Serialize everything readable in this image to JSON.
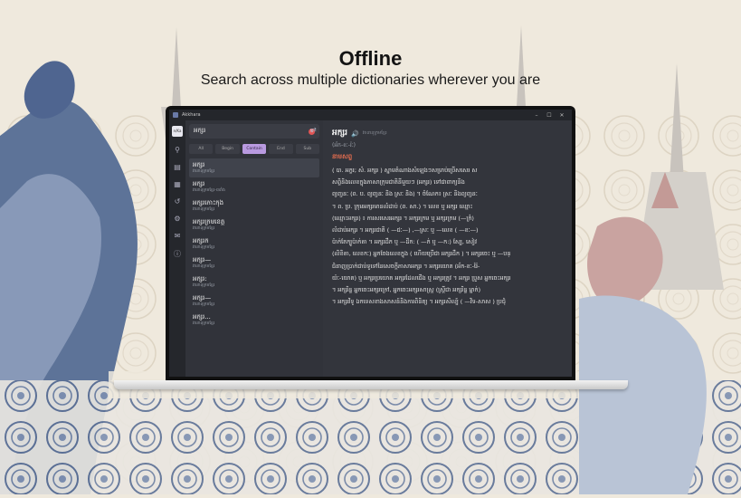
{
  "hero": {
    "title": "Offline",
    "subtitle": "Search across multiple dictionaries wherever you are"
  },
  "window": {
    "title": "Akkhara",
    "controls": [
      "–",
      "☐",
      "✕"
    ]
  },
  "rail": {
    "logo_text": "ក/Ka",
    "icons": [
      "search-icon",
      "book-icon",
      "dictionary-icon",
      "history-icon",
      "settings-icon",
      "mail-icon",
      "info-icon"
    ]
  },
  "search": {
    "query": "អក្សរ",
    "clear_symbol": "✕"
  },
  "filters": [
    {
      "label": "All",
      "active": false
    },
    {
      "label": "Begin",
      "active": false
    },
    {
      "label": "Contain",
      "active": true
    },
    {
      "label": "End",
      "active": false
    },
    {
      "label": "Sub",
      "active": false
    }
  ],
  "entries": [
    {
      "word": "អក្សរ",
      "source": "វចនានុក្រមខ្មែរ",
      "selected": true
    },
    {
      "word": "អក្សរ",
      "source": "វចនានុក្រមខ្មែរ-បារាំង",
      "selected": false
    },
    {
      "word": "អក្សរកោះកុង",
      "source": "វចនានុក្រមខ្មែរ",
      "selected": false
    },
    {
      "word": "អក្សរក្រមខេត្ត",
      "source": "វចនានុក្រមខ្មែរ",
      "selected": false
    },
    {
      "word": "អក្សរក",
      "source": "វចនានុក្រមខ្មែរ",
      "selected": false
    },
    {
      "word": "អក្សរ—",
      "source": "វចនានុក្រមខ្មែរ",
      "selected": false
    },
    {
      "word": "អក្សរ:",
      "source": "វចនានុក្រមខ្មែរ",
      "selected": false
    },
    {
      "word": "អក្សរ—",
      "source": "វចនានុក្រមខ្មែរ",
      "selected": false
    },
    {
      "word": "អក្សរ...",
      "source": "វចនានុក្រមខ្មែរ",
      "selected": false
    }
  ],
  "detail": {
    "word": "អក្សរ",
    "source": "វចនានុក្រមខ្មែរ",
    "pronunciation": "(អ័ក-ខៈ-រ៉ៈ)",
    "part_of_speech": "នាមសព្ទ",
    "lines": [
      "( បា. អក្ខរ; សំ. អក្សរ ) ស្នាមតំណាងសំឡេងៗសម្រាប់ប្រើសសេរ ស",
      "សព្ទិនិងលេខក្នុងភាសាក្រុមជាតិនីមួយៗ (អក្សរ) ទៅជាពាក្យនិង",
      "ព្យញ្ជនៈ (ព. ប. ព្យញ្ជនៈ និង ស្រៈ និង) ។ ចំណែក៖ ស្រៈ និងព្យញ្ជនៈ",
      "។ ព. ប្រ. ក្រុមអក្សរមានលំដាប់ (ព. សា.) ។ លេខ ឬ អក្សរ ឈ្មោះ",
      "(ឈ្មោះអក្សរ) ៖ ការសរសេរអក្សរ ។ អក្សរក្រម ឬ អក្សរក្រម (—ក្រំ)",
      "លំដាប់អក្សរ ។ អក្សរជាតិ ( —ជៈ—) ,—ស្រៈ ឬ —លេខ ( —ខៈ—)",
      "ប៉ាក់តែក្បូប៉ាក់តា ។ អក្សរដឹក ឬ —ដឹក: ( —ក់ ឬ —ក:) ស្បែ, សៀវ",
      "(លិខិតា, លេខកៈ) អ្នកចែងលេខក្នុង ( ហើយប្រើជា អក្សរដឹក ) ។ អក្សរចេះ ឬ —បន្",
      "ជំនាញប្រាក់ជាប់ទូទៅនៃសេចក្ដីភាសាអក្សរ ។ អក្សរយោគ (អ័ក-ខៈ-រ៉ៃ-",
      "យ៉ៈ-យោគ) ឬ អក្សរប្រយោគ អក្សរដែលជើង ឬ អក្សរត្រូវ ។ អក្សរ ប្រួស អ្នកចេះអក្សរ",
      "។ អក្សរិន្ទ អ្នកចេះអក្សរក្រៅ, អ្នកចេះអក្សរសាស្ត្រ (ស្ត្រីជា អក្សរិន្ទ ម្នាក់)",
      "។ អក្សរវិទូ ឯកទេសខាងសាសន៍និងការពិនិត្យ ។ អក្សរសិល្ប៍ ( —វិទ-សាស ) ប្រជុំ"
    ]
  }
}
